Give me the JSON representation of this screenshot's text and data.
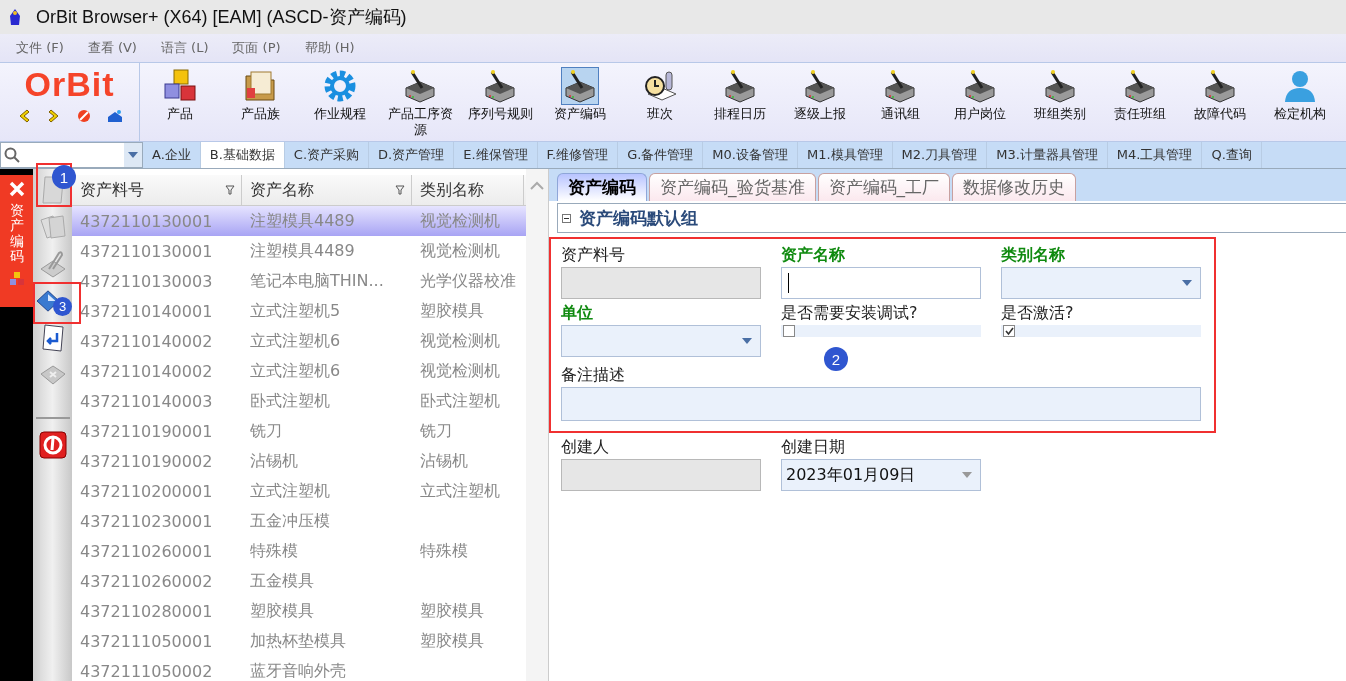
{
  "window": {
    "title": "OrBit Browser+ (X64) [EAM] (ASCD-资产编码)"
  },
  "menu": [
    "文件 (F)",
    "查看 (V)",
    "语言 (L)",
    "页面 (P)",
    "帮助 (H)"
  ],
  "logo": "OrBit",
  "tools": [
    {
      "label": "产品",
      "kind": "cubes",
      "selected": false
    },
    {
      "label": "产品族",
      "kind": "folder",
      "selected": false
    },
    {
      "label": "作业规程",
      "kind": "gear",
      "selected": false
    },
    {
      "label": "产品工序资源",
      "kind": "machine",
      "selected": false
    },
    {
      "label": "序列号规则",
      "kind": "machine",
      "selected": false
    },
    {
      "label": "资产编码",
      "kind": "machine",
      "selected": true
    },
    {
      "label": "班次",
      "kind": "clock",
      "selected": false
    },
    {
      "label": "排程日历",
      "kind": "machine",
      "selected": false
    },
    {
      "label": "逐级上报",
      "kind": "machine",
      "selected": false
    },
    {
      "label": "通讯组",
      "kind": "machine",
      "selected": false
    },
    {
      "label": "用户岗位",
      "kind": "machine",
      "selected": false
    },
    {
      "label": "班组类别",
      "kind": "machine",
      "selected": false
    },
    {
      "label": "责任班组",
      "kind": "machine",
      "selected": false
    },
    {
      "label": "故障代码",
      "kind": "machine",
      "selected": false
    },
    {
      "label": "检定机构",
      "kind": "person",
      "selected": false
    }
  ],
  "module_tabs": [
    {
      "label": "A.企业",
      "selected": false
    },
    {
      "label": "B.基础数据",
      "selected": true
    },
    {
      "label": "C.资产采购",
      "selected": false
    },
    {
      "label": "D.资产管理",
      "selected": false
    },
    {
      "label": "E.维保管理",
      "selected": false
    },
    {
      "label": "F.维修管理",
      "selected": false
    },
    {
      "label": "G.备件管理",
      "selected": false
    },
    {
      "label": "M0.设备管理",
      "selected": false
    },
    {
      "label": "M1.模具管理",
      "selected": false
    },
    {
      "label": "M2.刀具管理",
      "selected": false
    },
    {
      "label": "M3.计量器具管理",
      "selected": false
    },
    {
      "label": "M4.工具管理",
      "selected": false
    },
    {
      "label": "Q.查询",
      "selected": false
    }
  ],
  "side_tab": {
    "label": "资产编码"
  },
  "list": {
    "columns": [
      {
        "label": "资产料号",
        "filter": true
      },
      {
        "label": "资产名称",
        "filter": true
      },
      {
        "label": "类别名称",
        "filter": false
      }
    ],
    "rows": [
      {
        "cells": [
          "4372110130001",
          "注塑模具4489",
          "视觉检测机"
        ],
        "selected": true
      },
      {
        "cells": [
          "4372110130001",
          "注塑模具4489",
          "视觉检测机"
        ],
        "selected": false
      },
      {
        "cells": [
          "4372110130003",
          "笔记本电脑THIN...",
          "光学仪器校准"
        ],
        "selected": false
      },
      {
        "cells": [
          "4372110140001",
          "立式注塑机5",
          "塑胶模具"
        ],
        "selected": false
      },
      {
        "cells": [
          "4372110140002",
          "立式注塑机6",
          "视觉检测机"
        ],
        "selected": false
      },
      {
        "cells": [
          "4372110140002",
          "立式注塑机6",
          "视觉检测机"
        ],
        "selected": false
      },
      {
        "cells": [
          "4372110140003",
          "卧式注塑机",
          "卧式注塑机"
        ],
        "selected": false
      },
      {
        "cells": [
          "4372110190001",
          "铣刀",
          "铣刀"
        ],
        "selected": false
      },
      {
        "cells": [
          "4372110190002",
          "沾锡机",
          "沾锡机"
        ],
        "selected": false
      },
      {
        "cells": [
          "4372110200001",
          "立式注塑机",
          "立式注塑机"
        ],
        "selected": false
      },
      {
        "cells": [
          "4372110230001",
          "五金冲压模",
          ""
        ],
        "selected": false
      },
      {
        "cells": [
          "4372110260001",
          "特殊模",
          "特殊模"
        ],
        "selected": false
      },
      {
        "cells": [
          "4372110260002",
          "五金模具",
          ""
        ],
        "selected": false
      },
      {
        "cells": [
          "4372110280001",
          "塑胶模具",
          "塑胶模具"
        ],
        "selected": false
      },
      {
        "cells": [
          "4372111050001",
          "加热杯垫模具",
          "塑胶模具"
        ],
        "selected": false
      },
      {
        "cells": [
          "4372111050002",
          "蓝牙音响外壳",
          ""
        ],
        "selected": false
      }
    ]
  },
  "form_tabs": [
    {
      "label": "资产编码",
      "selected": true
    },
    {
      "label": "资产编码_验货基准",
      "selected": false
    },
    {
      "label": "资产编码_工厂",
      "selected": false
    },
    {
      "label": "数据修改历史",
      "selected": false
    }
  ],
  "group": {
    "title": "资产编码默认组",
    "expanded": true
  },
  "fields": [
    {
      "kind": "text",
      "label": "资产料号",
      "required": false,
      "readonly": true,
      "focused": false
    },
    {
      "kind": "text",
      "label": "资产名称",
      "required": true,
      "readonly": false,
      "focused": true
    },
    {
      "kind": "dropdown",
      "label": "类别名称",
      "required": true,
      "readonly": false
    },
    {
      "kind": "dropdown",
      "label": "单位",
      "required": true,
      "readonly": false
    },
    {
      "kind": "checkbox",
      "label": "是否需要安装调试?",
      "checked": false
    },
    {
      "kind": "checkbox",
      "label": "是否激活?",
      "checked": true
    },
    {
      "kind": "memo",
      "label": "备注描述"
    }
  ],
  "extra_fields": [
    {
      "kind": "text",
      "label": "创建人",
      "required": false,
      "readonly": true,
      "focused": false
    },
    {
      "kind": "dropdown",
      "label": "创建日期",
      "required": false,
      "readonly": true,
      "value": "2023年01月09日"
    }
  ],
  "callouts": [
    "1",
    "2",
    "3"
  ]
}
